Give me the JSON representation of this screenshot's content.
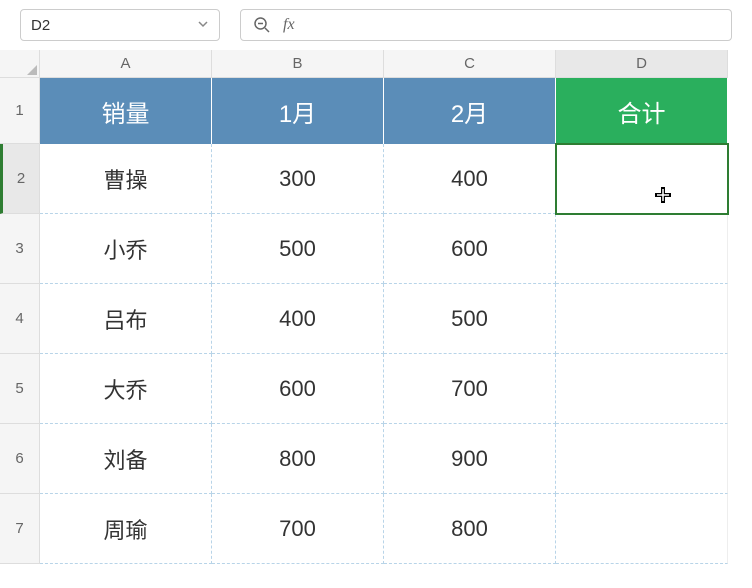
{
  "toolbar": {
    "name_box": "D2",
    "fx_label": "fx"
  },
  "columns": [
    "A",
    "B",
    "C",
    "D"
  ],
  "row_numbers": [
    "1",
    "2",
    "3",
    "4",
    "5",
    "6",
    "7"
  ],
  "selected_cell": {
    "row": 2,
    "col": "D"
  },
  "headers": {
    "c0": "销量",
    "c1": "1月",
    "c2": "2月",
    "c3": "合计"
  },
  "data": [
    {
      "name": "曹操",
      "m1": "300",
      "m2": "400",
      "total": ""
    },
    {
      "name": "小乔",
      "m1": "500",
      "m2": "600",
      "total": ""
    },
    {
      "name": "吕布",
      "m1": "400",
      "m2": "500",
      "total": ""
    },
    {
      "name": "大乔",
      "m1": "600",
      "m2": "700",
      "total": ""
    },
    {
      "name": "刘备",
      "m1": "800",
      "m2": "900",
      "total": ""
    },
    {
      "name": "周瑜",
      "m1": "700",
      "m2": "800",
      "total": ""
    }
  ],
  "chart_data": {
    "type": "table",
    "title": "销量",
    "columns": [
      "销量",
      "1月",
      "2月",
      "合计"
    ],
    "rows": [
      [
        "曹操",
        300,
        400,
        null
      ],
      [
        "小乔",
        500,
        600,
        null
      ],
      [
        "吕布",
        400,
        500,
        null
      ],
      [
        "大乔",
        600,
        700,
        null
      ],
      [
        "刘备",
        800,
        900,
        null
      ],
      [
        "周瑜",
        700,
        800,
        null
      ]
    ]
  }
}
